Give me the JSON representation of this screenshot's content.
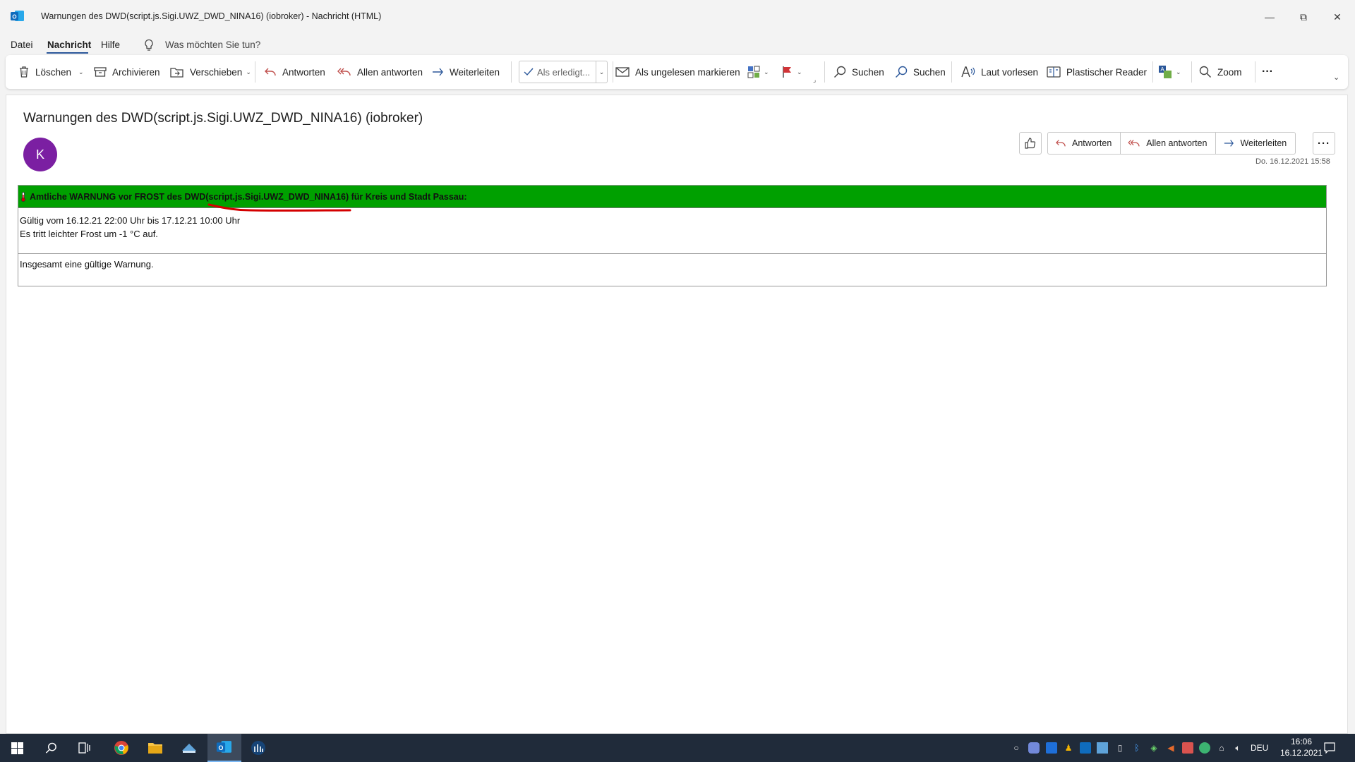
{
  "window": {
    "title": "Warnungen des DWD(script.js.Sigi.UWZ_DWD_NINA16) (iobroker)  -  Nachricht (HTML)",
    "minimize": "—",
    "maximize": "⧉",
    "close": "✕"
  },
  "menu": {
    "items": [
      "Datei",
      "Nachricht",
      "Hilfe"
    ],
    "active": "Nachricht",
    "search_placeholder": "Was möchten Sie tun?"
  },
  "ribbon": {
    "delete": "Löschen",
    "archive": "Archivieren",
    "move": "Verschieben",
    "reply": "Antworten",
    "reply_all": "Allen antworten",
    "forward": "Weiterleiten",
    "quick_step": "Als erledigt...",
    "mark_unread": "Als ungelesen markieren",
    "search1": "Suchen",
    "search2": "Suchen",
    "read_aloud": "Laut vorlesen",
    "immersive_reader": "Plastischer Reader",
    "zoom": "Zoom",
    "more": "···"
  },
  "message": {
    "subject": "Warnungen des DWD(script.js.Sigi.UWZ_DWD_NINA16) (iobroker)",
    "sender_initial": "K",
    "date": "Do. 16.12.2021 15:58",
    "actions": {
      "reply": "Antworten",
      "reply_all": "Allen antworten",
      "forward": "Weiterleiten",
      "more": "···"
    },
    "body": {
      "header": "Amtliche WARNUNG vor FROST des DWD(script.js.Sigi.UWZ_DWD_NINA16) für Kreis und Stadt Passau:",
      "line1": "Gültig vom 16.12.21 22:00 Uhr bis 17.12.21 10:00 Uhr",
      "line2": "Es tritt leichter Frost um -1 °C auf.",
      "summary": "Insgesamt eine gültige Warnung."
    }
  },
  "taskbar": {
    "language": "DEU",
    "time": "16:06",
    "date": "16.12.2021"
  },
  "colors": {
    "warning_header_bg": "#00a000",
    "avatar_bg": "#7b1fa2",
    "taskbar_bg": "#202b3a",
    "outlook_blue": "#0f6cbd",
    "annotation_red": "#d40000"
  }
}
